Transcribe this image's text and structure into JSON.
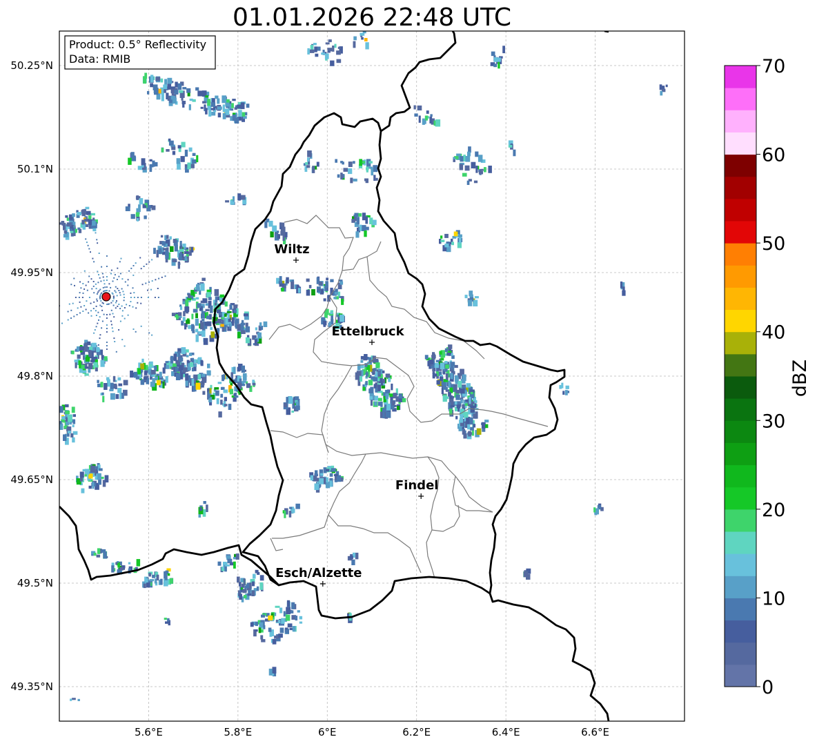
{
  "title": "01.01.2026 22:48 UTC",
  "info_box": {
    "product": "Product: 0.5° Reflectivity",
    "source": "Data: RMIB"
  },
  "latitude_labels": [
    "50.25°N",
    "50.1°N",
    "49.95°N",
    "49.8°N",
    "49.65°N",
    "49.5°N",
    "49.35°N"
  ],
  "longitude_labels": [
    "5.6°E",
    "5.8°E",
    "6°E",
    "6.2°E",
    "6.4°E",
    "6.6°E"
  ],
  "extent": {
    "lon_min": 5.4,
    "lon_max": 6.8,
    "lat_min": 49.3,
    "lat_max": 50.3
  },
  "cities": [
    {
      "name": "Wiltz",
      "lon": 5.93,
      "lat": 49.968
    },
    {
      "name": "Ettelbruck",
      "lon": 6.1,
      "lat": 49.849
    },
    {
      "name": "Findel",
      "lon": 6.21,
      "lat": 49.626
    },
    {
      "name": "Esch/Alzette",
      "lon": 5.99,
      "lat": 49.499
    }
  ],
  "radar_site": {
    "lon": 5.505,
    "lat": 49.915,
    "color": "#e8141b"
  },
  "colorbar": {
    "label": "dBZ",
    "min": 0,
    "max": 70,
    "tick_labels": [
      "0",
      "10",
      "20",
      "30",
      "40",
      "50",
      "60",
      "70"
    ],
    "colors": [
      "#6374a8",
      "#55699f",
      "#465e9e",
      "#4a79b0",
      "#58a0c8",
      "#68c1dc",
      "#5fd5c0",
      "#3ed46b",
      "#15c827",
      "#10b81d",
      "#0e9f13",
      "#0c8811",
      "#0a7410",
      "#0b5b0d",
      "#437613",
      "#a9b108",
      "#ffd600",
      "#ffb603",
      "#ff9a01",
      "#ff7f03",
      "#e20606",
      "#c00000",
      "#a20000",
      "#7e0000",
      "#ffdefe",
      "#ffb1fd",
      "#fe6ff9",
      "#e935e9"
    ]
  }
}
